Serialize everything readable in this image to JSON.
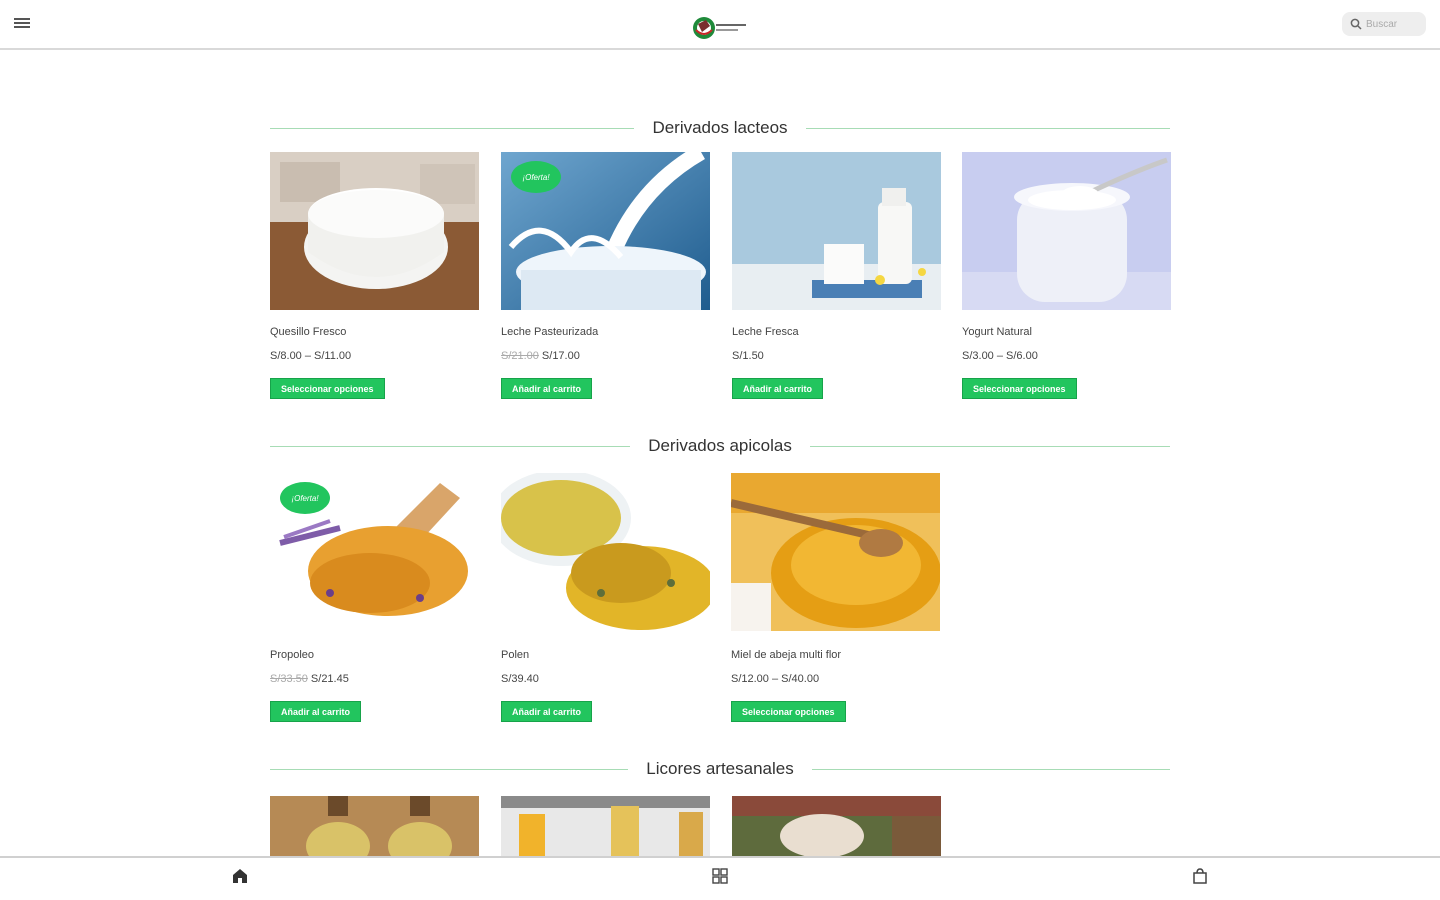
{
  "header": {
    "menu_icon": "hamburger-menu-icon",
    "logo_icon": "store-logo-icon",
    "search_placeholder": "Buscar",
    "search_icon": "search-icon"
  },
  "sections": [
    {
      "title": "Derivados lacteos",
      "products": [
        {
          "name": "Quesillo Fresco",
          "old_price": "",
          "price": "S/8.00 – S/11.00",
          "button": "Seleccionar opciones",
          "badge": ""
        },
        {
          "name": "Leche Pasteurizada",
          "old_price": "S/21.00",
          "price": "S/17.00",
          "button": "Añadir al carrito",
          "badge": "¡Oferta!"
        },
        {
          "name": "Leche Fresca",
          "old_price": "",
          "price": "S/1.50",
          "button": "Añadir al carrito",
          "badge": ""
        },
        {
          "name": "Yogurt Natural",
          "old_price": "",
          "price": "S/3.00 – S/6.00",
          "button": "Seleccionar opciones",
          "badge": ""
        }
      ]
    },
    {
      "title": "Derivados apicolas",
      "products": [
        {
          "name": "Propoleo",
          "old_price": "S/33.50",
          "price": "S/21.45",
          "button": "Añadir al carrito",
          "badge": "¡Oferta!"
        },
        {
          "name": "Polen",
          "old_price": "",
          "price": "S/39.40",
          "button": "Añadir al carrito",
          "badge": ""
        },
        {
          "name": "Miel de abeja multi flor",
          "old_price": "",
          "price": "S/12.00 – S/40.00",
          "button": "Seleccionar opciones",
          "badge": ""
        }
      ]
    },
    {
      "title": "Licores artesanales",
      "products": []
    }
  ],
  "bottom_nav": {
    "home_icon": "home-icon",
    "categories_icon": "grid-icon",
    "cart_icon": "shopping-bag-icon"
  },
  "colors": {
    "accent": "#22c55e",
    "divider": "#a7dcb5"
  }
}
